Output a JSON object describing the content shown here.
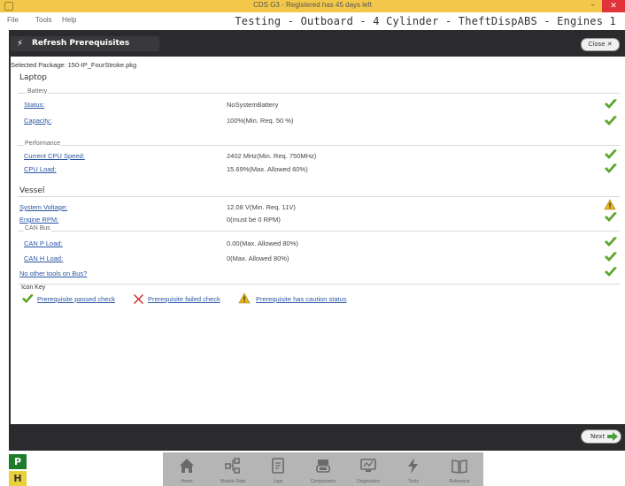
{
  "window": {
    "title": "CDS G3 - Registered has 45 days left",
    "app_title": "Testing - Outboard - 4 Cylinder - TheftDispABS - Engines 1"
  },
  "menu": [
    "File",
    "Tools",
    "Help"
  ],
  "header": {
    "title": "Refresh Prerequisites",
    "close_label": "Close"
  },
  "selected_package": "Selected Package: 150-IP_FourStroke.pkg",
  "sections": {
    "laptop": "Laptop",
    "battery": "Battery",
    "performance": "Performance",
    "vessel": "Vessel",
    "can_bus": "CAN Bus"
  },
  "rows": {
    "status": {
      "label": "Status:",
      "value": "NoSystemBattery"
    },
    "capacity": {
      "label": "Capacity:",
      "value": "100%(Min. Req. 50 %)"
    },
    "cpu_speed": {
      "label": "Current CPU Speed:",
      "value": "2402 MHz(Min. Req. 750MHz)"
    },
    "cpu_load": {
      "label": "CPU Load:",
      "value": "15.69%(Max. Allowed 60%)"
    },
    "system_voltage": {
      "label": "System Voltage:",
      "value": "12.08 V(Min. Req. 11V)"
    },
    "engine_rpm": {
      "label": "Engine RPM:",
      "value": "0(must be 0 RPM)"
    },
    "can_p_load": {
      "label": "CAN P Load:",
      "value": "0.00(Max. Allowed 80%)"
    },
    "can_h_load": {
      "label": "CAN H Load:",
      "value": "0(Max. Allowed 80%)"
    },
    "other_tools": {
      "label": "No other tools on Bus?"
    }
  },
  "icon_key": {
    "title": "Icon Key",
    "passed": "Prerequisite passed check",
    "failed": "Prerequisite failed check",
    "caution": "Prerequisite has caution status"
  },
  "next_label": "Next",
  "left_badges": {
    "p": "P",
    "h": "H"
  },
  "nav": [
    "Home",
    "Module Data",
    "Logs",
    "Components",
    "Diagnostics",
    "Tools",
    "Reference"
  ],
  "colors": {
    "title_bar": "#f3c84a",
    "check_green": "#5da52e",
    "link": "#2b56a4",
    "dark_frame": "#2b2b2d"
  }
}
